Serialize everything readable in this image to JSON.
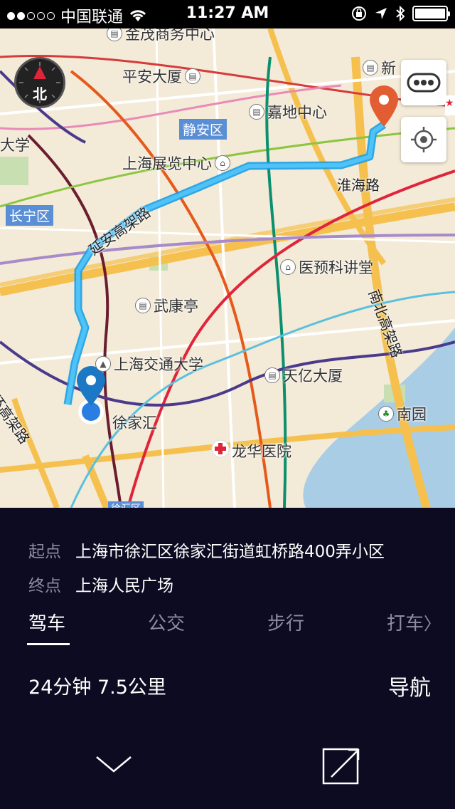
{
  "status_bar": {
    "carrier": "中国联通",
    "time": "11:27 AM",
    "signal_dots_filled": 2,
    "signal_dots_total": 5
  },
  "map": {
    "compass_label": "北",
    "labels": {
      "jinmao": "金茂商务中心",
      "pingan": "平安大厦",
      "xinshijie": "新",
      "daxue_left": "大学",
      "jingan": "静安区",
      "jiadi": "嘉地中心",
      "zhanlan": "上海展览中心",
      "huaihai": "淮海路",
      "changning": "长宁区",
      "yanan": "延安高架路",
      "yiyu": "医预科讲堂",
      "wukang": "武康亭",
      "nanbei": "南北高架路",
      "jiaotong": "上海交通大学",
      "tianyi": "天亿大厦",
      "xujiahui": "徐家汇",
      "nanyuan": "南园",
      "huanquan": "环高架路",
      "longhua": "龙华医院",
      "xuhui_bottom": "徐汇区"
    },
    "colors": {
      "route": "#29b6f6",
      "start_pin": "#1b78c4",
      "end_pin": "#e25d32",
      "district_badge": "#5a8fd6"
    }
  },
  "panel": {
    "start_label": "起点",
    "start_value": "上海市徐汇区徐家汇街道虹桥路400弄小区",
    "end_label": "终点",
    "end_value": "上海人民广场",
    "tabs": [
      "驾车",
      "公交",
      "步行",
      "打车"
    ],
    "active_tab": "驾车",
    "summary": "24分钟 7.5公里",
    "navigate_label": "导航"
  }
}
